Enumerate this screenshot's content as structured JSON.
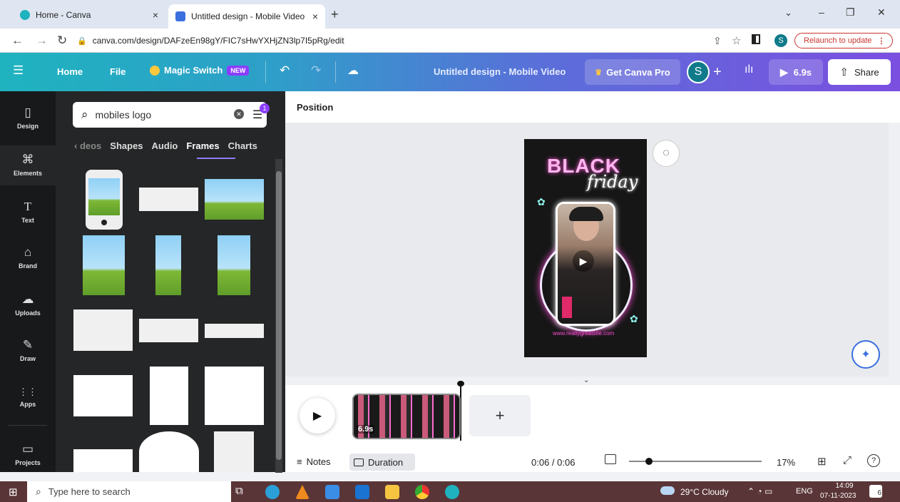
{
  "browser": {
    "tabs": [
      {
        "label": "Home - Canva",
        "close": "×"
      },
      {
        "label": "Untitled design - Mobile Video",
        "close": "×"
      }
    ],
    "new_tab": "+",
    "url": "canva.com/design/DAFzeEn98gY/FIC7sHwYXHjZN3lp7I5pRg/edit",
    "profile_initial": "S",
    "relaunch_label": "Relaunch to update",
    "window_controls": [
      "⌄",
      "–",
      "❐",
      "✕"
    ]
  },
  "header": {
    "home": "Home",
    "file": "File",
    "magic_switch": "Magic Switch",
    "new_badge": "NEW",
    "doc_title": "Untitled design - Mobile Video",
    "get_pro": "Get Canva Pro",
    "avatar_initial": "S",
    "play_time": "6.9s",
    "share": "Share"
  },
  "rail": [
    {
      "label": "Design",
      "icon": "▯"
    },
    {
      "label": "Elements",
      "icon": "⌘"
    },
    {
      "label": "Text",
      "icon": "T"
    },
    {
      "label": "Brand",
      "icon": "⌂"
    },
    {
      "label": "Uploads",
      "icon": "☁"
    },
    {
      "label": "Draw",
      "icon": "✎"
    },
    {
      "label": "Apps",
      "icon": "⋮⋮"
    },
    {
      "label": "Projects",
      "icon": "▭"
    }
  ],
  "panel": {
    "search_value": "mobiles logo",
    "filter_count": "1",
    "categories": [
      "‹ deos",
      "Shapes",
      "Audio",
      "Frames",
      "Charts"
    ]
  },
  "workspace": {
    "position_label": "Position",
    "design_headline": "BLACK",
    "design_script": "friday",
    "design_url": "www.reallygreatsite.com",
    "clip_duration": "6.9s",
    "add_page": "+"
  },
  "footer": {
    "notes": "Notes",
    "duration": "Duration",
    "time": "0:06 / 0:06",
    "zoom": "17%",
    "help": "?",
    "zoom_level": 0.15
  },
  "taskbar": {
    "search_placeholder": "Type here to search",
    "weather": "29°C  Cloudy",
    "lang": "ENG",
    "time": "14:09",
    "date": "07-11-2023",
    "notif_count": "6"
  },
  "colors": {
    "accent": "#8b3dff",
    "relaunch": "#c9352e",
    "neon_pink": "#ff4fd8"
  }
}
